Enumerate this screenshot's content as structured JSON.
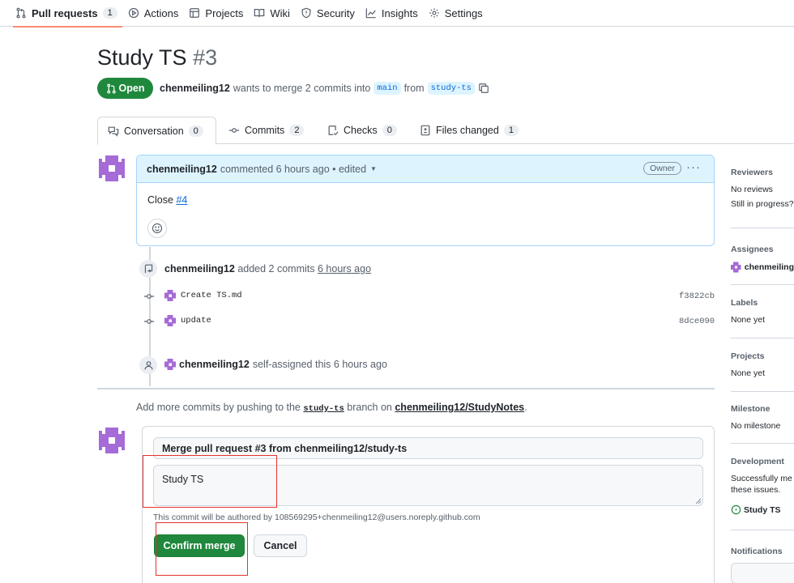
{
  "repo_tabs": [
    {
      "label": "Pull requests",
      "count": "1",
      "icon": "pull-request-icon",
      "active": true
    },
    {
      "label": "Actions",
      "icon": "play-icon"
    },
    {
      "label": "Projects",
      "icon": "table-icon"
    },
    {
      "label": "Wiki",
      "icon": "book-icon"
    },
    {
      "label": "Security",
      "icon": "shield-icon"
    },
    {
      "label": "Insights",
      "icon": "graph-icon"
    },
    {
      "label": "Settings",
      "icon": "gear-icon"
    }
  ],
  "pr": {
    "title": "Study TS",
    "number": "#3",
    "state": "Open",
    "author": "chenmeiling12",
    "summary": "wants to merge 2 commits into",
    "base": "main",
    "from": "from",
    "head": "study-ts"
  },
  "pr_tabs": [
    {
      "label": "Conversation",
      "count": "0"
    },
    {
      "label": "Commits",
      "count": "2"
    },
    {
      "label": "Checks",
      "count": "0"
    },
    {
      "label": "Files changed",
      "count": "1"
    }
  ],
  "comment": {
    "author": "chenmeiling12",
    "meta": "commented 6 hours ago • edited",
    "role": "Owner",
    "body_prefix": "Close",
    "body_link": "#4"
  },
  "commits_event": {
    "author": "chenmeiling12",
    "text": "added 2 commits",
    "time": "6 hours ago"
  },
  "commits": [
    {
      "message": "Create TS.md",
      "sha": "f3822cb"
    },
    {
      "message": "update",
      "sha": "8dce090"
    }
  ],
  "assign_event": {
    "author": "chenmeiling12",
    "text": "self-assigned this 6 hours ago"
  },
  "hint": {
    "prefix": "Add more commits by pushing to the",
    "branch": "study-ts",
    "middle": "branch on",
    "repo": "chenmeiling12/StudyNotes",
    "suffix": "."
  },
  "merge": {
    "title_value": "Merge pull request #3 from chenmeiling12/study-ts",
    "body_value": "Study TS",
    "author_note": "This commit will be authored by 108569295+chenmeiling12@users.noreply.github.com",
    "confirm_label": "Confirm merge",
    "cancel_label": "Cancel"
  },
  "sidebar": {
    "reviewers_title": "Reviewers",
    "reviewers_value": "No reviews",
    "reviewers_note": "Still in progress?",
    "assignees_title": "Assignees",
    "assignees_value": "chenmeiling",
    "labels_title": "Labels",
    "labels_value": "None yet",
    "projects_title": "Projects",
    "projects_value": "None yet",
    "milestone_title": "Milestone",
    "milestone_value": "No milestone",
    "development_title": "Development",
    "development_line1": "Successfully me",
    "development_line2": "these issues.",
    "development_issue": "Study TS",
    "notifications_title": "Notifications"
  },
  "colors": {
    "accent_green": "#1f883d",
    "link_blue": "#0969da",
    "highlight_red": "#e5322d",
    "tab_underline": "#fd8c73"
  }
}
